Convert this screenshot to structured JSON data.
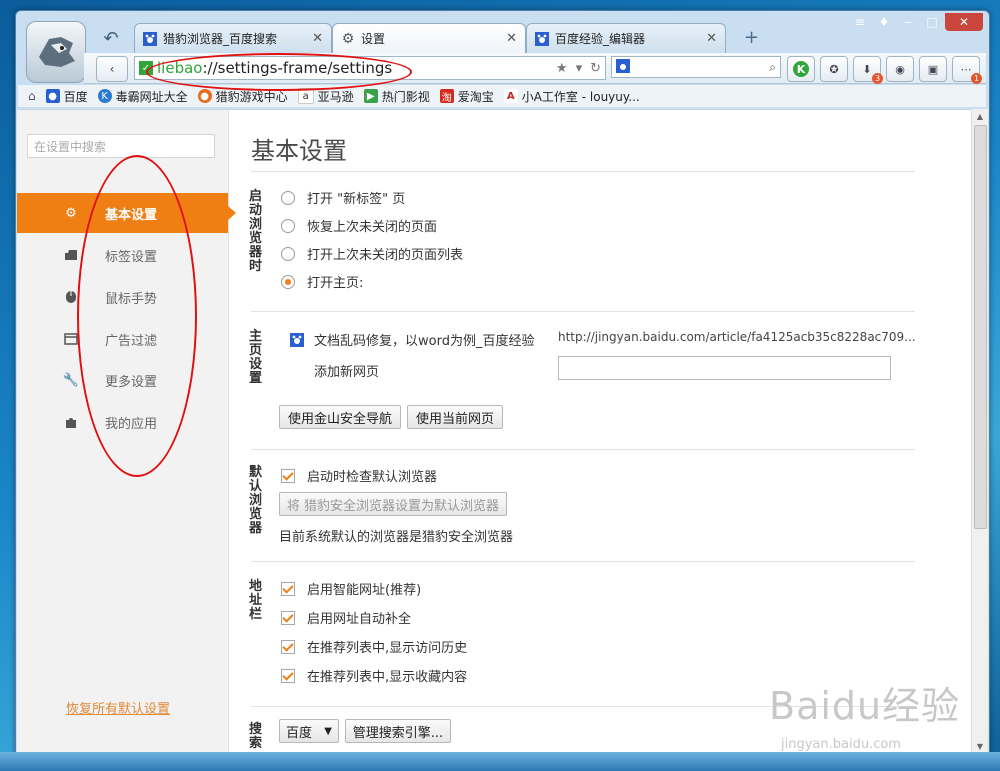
{
  "tabs": [
    {
      "label": "猎豹浏览器_百度搜索",
      "icon": "paw-icon",
      "active": false
    },
    {
      "label": "设置",
      "icon": "gear-icon",
      "active": true
    },
    {
      "label": "百度经验_编辑器",
      "icon": "paw-icon",
      "active": false
    }
  ],
  "address": {
    "protocol": "liebao",
    "rest": "://settings-frame/settings"
  },
  "bookmarks": [
    {
      "label": "百度",
      "icon": "paw-icon",
      "color": "#2a5fd0"
    },
    {
      "label": "毒霸网址大全",
      "icon": "k-icon",
      "color": "#2a7bd0"
    },
    {
      "label": "猎豹游戏中心",
      "icon": "game-icon",
      "color": "#e86b1e"
    },
    {
      "label": "亚马逊",
      "icon": "amazon-icon",
      "color": "#333333"
    },
    {
      "label": "热门影视",
      "icon": "play-icon",
      "color": "#3aa14a"
    },
    {
      "label": "爱淘宝",
      "icon": "taobao-icon",
      "color": "#d42c1e"
    },
    {
      "label": "小A工作室 - louyuy...",
      "icon": "a-icon",
      "color": "#cc2222"
    }
  ],
  "sidebar": {
    "search_placeholder": "在设置中搜索",
    "items": [
      {
        "label": "基本设置",
        "icon": "gear-icon",
        "active": true
      },
      {
        "label": "标签设置",
        "icon": "tab-icon",
        "active": false
      },
      {
        "label": "鼠标手势",
        "icon": "mouse-icon",
        "active": false
      },
      {
        "label": "广告过滤",
        "icon": "window-icon",
        "active": false
      },
      {
        "label": "更多设置",
        "icon": "wrench-icon",
        "active": false
      },
      {
        "label": "我的应用",
        "icon": "puzzle-icon",
        "active": false
      }
    ],
    "restore_link": "恢复所有默认设置"
  },
  "main": {
    "title": "基本设置",
    "startup": {
      "label": "启动浏览器时",
      "options": [
        {
          "label": "打开 \"新标签\" 页",
          "selected": false
        },
        {
          "label": "恢复上次未关闭的页面",
          "selected": false
        },
        {
          "label": "打开上次未关闭的页面列表",
          "selected": false
        },
        {
          "label": "打开主页:",
          "selected": true
        }
      ]
    },
    "homepage": {
      "label": "主页设置",
      "page_title": "文档乱码修复，以word为例_百度经验",
      "page_url": "http://jingyan.baidu.com/article/fa4125acb35c8228ac709...",
      "add_label": "添加新网页",
      "add_value": "",
      "btn_nav": "使用金山安全导航",
      "btn_current": "使用当前网页"
    },
    "default_browser": {
      "label": "默认浏览器",
      "check_label": "启动时检查默认浏览器",
      "checked": true,
      "set_button": "将 猎豹安全浏览器设置为默认浏览器",
      "status": "目前系统默认的浏览器是猎豹安全浏览器"
    },
    "addressbar": {
      "label": "地址栏",
      "options": [
        {
          "label": "启用智能网址(推荐)",
          "checked": true
        },
        {
          "label": "启用网址自动补全",
          "checked": true
        },
        {
          "label": "在推荐列表中,显示访问历史",
          "checked": true
        },
        {
          "label": "在推荐列表中,显示收藏内容",
          "checked": true
        }
      ]
    },
    "search": {
      "label": "搜索",
      "engine": "百度",
      "manage_button": "管理搜索引擎..."
    }
  },
  "watermark": {
    "main": "Baidu经验",
    "sub": "jingyan.baidu.com"
  }
}
